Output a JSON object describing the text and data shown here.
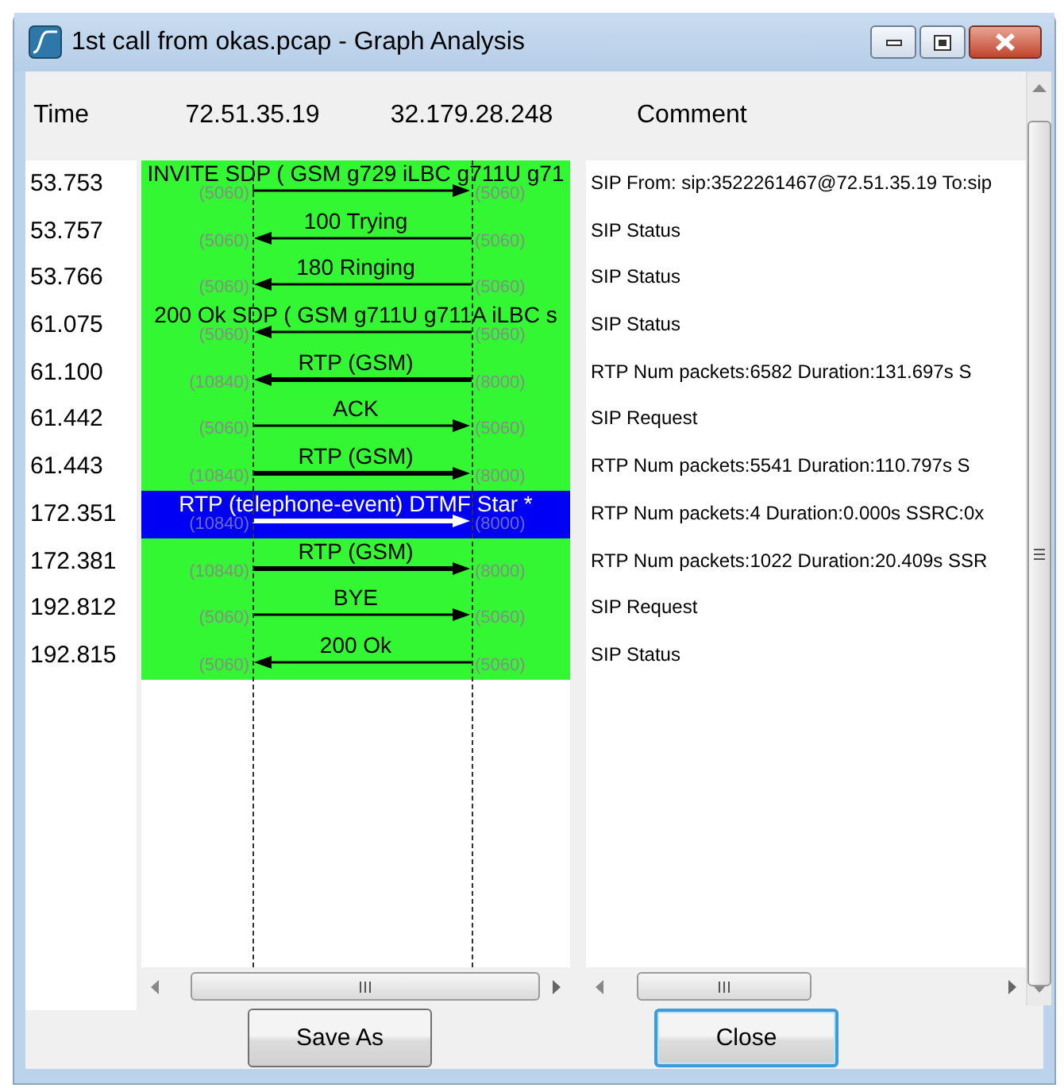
{
  "window": {
    "title": "1st call from okas.pcap - Graph Analysis"
  },
  "header": {
    "time": "Time",
    "node_1": "72.51.35.19",
    "node_2": "32.179.28.248",
    "comment": "Comment"
  },
  "messages": [
    {
      "time": "53.753",
      "label": "INVITE SDP ( GSM g729 iLBC g711U g71",
      "leftward": false,
      "kind": "sip",
      "port_left": "(5060)",
      "port_right": "(5060)",
      "selected": false,
      "comment": "SIP From: sip:3522261467@72.51.35.19 To:sip"
    },
    {
      "time": "53.757",
      "label": "100 Trying",
      "leftward": true,
      "kind": "sip",
      "port_left": "(5060)",
      "port_right": "(5060)",
      "selected": false,
      "comment": "SIP Status"
    },
    {
      "time": "53.766",
      "label": "180 Ringing",
      "leftward": true,
      "kind": "sip",
      "port_left": "(5060)",
      "port_right": "(5060)",
      "selected": false,
      "comment": "SIP Status"
    },
    {
      "time": "61.075",
      "label": "200 Ok SDP ( GSM g711U g711A iLBC s",
      "leftward": true,
      "kind": "sip",
      "port_left": "(5060)",
      "port_right": "(5060)",
      "selected": false,
      "comment": "SIP Status"
    },
    {
      "time": "61.100",
      "label": "RTP (GSM)",
      "leftward": true,
      "kind": "rtp",
      "port_left": "(10840)",
      "port_right": "(8000)",
      "selected": false,
      "comment": "RTP Num packets:6582  Duration:131.697s S"
    },
    {
      "time": "61.442",
      "label": "ACK",
      "leftward": false,
      "kind": "sip",
      "port_left": "(5060)",
      "port_right": "(5060)",
      "selected": false,
      "comment": "SIP Request"
    },
    {
      "time": "61.443",
      "label": "RTP (GSM)",
      "leftward": false,
      "kind": "rtp",
      "port_left": "(10840)",
      "port_right": "(8000)",
      "selected": false,
      "comment": "RTP Num packets:5541  Duration:110.797s S"
    },
    {
      "time": "172.351",
      "label": "RTP (telephone-event) DTMF Star *",
      "leftward": false,
      "kind": "rtp",
      "port_left": "(10840)",
      "port_right": "(8000)",
      "selected": true,
      "comment": "RTP Num packets:4  Duration:0.000s SSRC:0x"
    },
    {
      "time": "172.381",
      "label": "RTP (GSM)",
      "leftward": false,
      "kind": "rtp",
      "port_left": "(10840)",
      "port_right": "(8000)",
      "selected": false,
      "comment": "RTP Num packets:1022  Duration:20.409s SSR"
    },
    {
      "time": "192.812",
      "label": "BYE",
      "leftward": false,
      "kind": "sip",
      "port_left": "(5060)",
      "port_right": "(5060)",
      "selected": false,
      "comment": "SIP Request"
    },
    {
      "time": "192.815",
      "label": "200 Ok",
      "leftward": true,
      "kind": "sip",
      "port_left": "(5060)",
      "port_right": "(5060)",
      "selected": false,
      "comment": "SIP Status"
    }
  ],
  "buttons": [
    {
      "label": "Save As",
      "default": false
    },
    {
      "label": "Close",
      "default": true
    }
  ]
}
